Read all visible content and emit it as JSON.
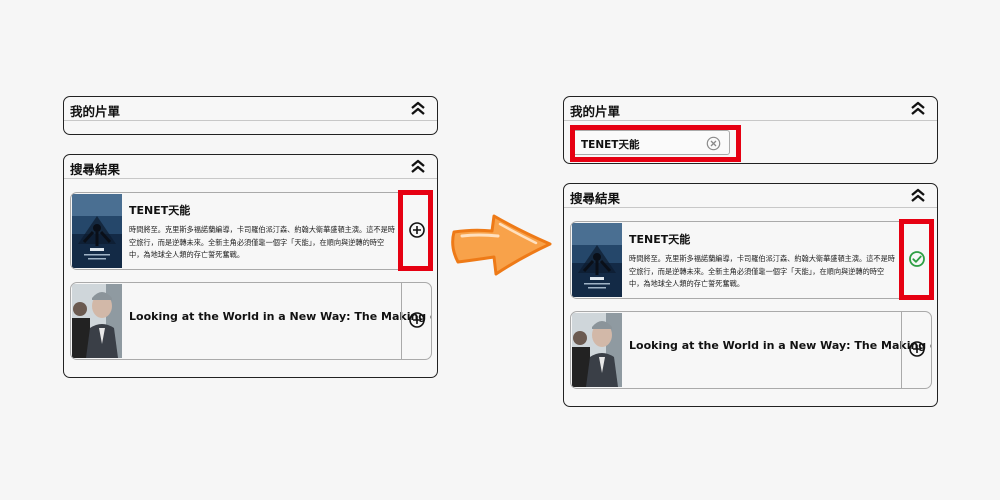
{
  "before": {
    "watchlist": {
      "title": "我的片單"
    },
    "search": {
      "title": "搜尋結果",
      "results": [
        {
          "title": "TENET天能",
          "description": "時間將至。克里斯多福諾蘭編導，卡司羅伯派汀森、約翰大衛華盛頓主演。這不是時空旅行，而是逆轉未來。全新主角必須僅靠一個字「天能」，在順向與逆轉的時空中，為地球全人類的存亡誓死奮戰。",
          "action_icon": "plus-circle-icon"
        },
        {
          "title": "Looking at the World in a New Way: The Making of...",
          "action_icon": "plus-circle-icon"
        }
      ]
    }
  },
  "after": {
    "watchlist": {
      "title": "我的片單",
      "chips": [
        {
          "label": "TENET天能"
        }
      ]
    },
    "search": {
      "title": "搜尋結果",
      "results": [
        {
          "title": "TENET天能",
          "description": "時間將至。克里斯多福諾蘭編導，卡司羅伯派汀森、約翰大衛華盛頓主演。這不是時空旅行，而是逆轉未來。全新主角必須僅靠一個字「天能」，在順向與逆轉的時空中，為地球全人類的存亡誓死奮戰。",
          "action_icon": "check-circle-icon"
        },
        {
          "title": "Looking at the World in a New Way: The Making of...",
          "action_icon": "plus-circle-icon"
        }
      ]
    }
  },
  "colors": {
    "highlight": "#e60012",
    "check": "#2e9e44",
    "arrow_fill": "#f8a24a",
    "arrow_stroke": "#ee7a17"
  }
}
